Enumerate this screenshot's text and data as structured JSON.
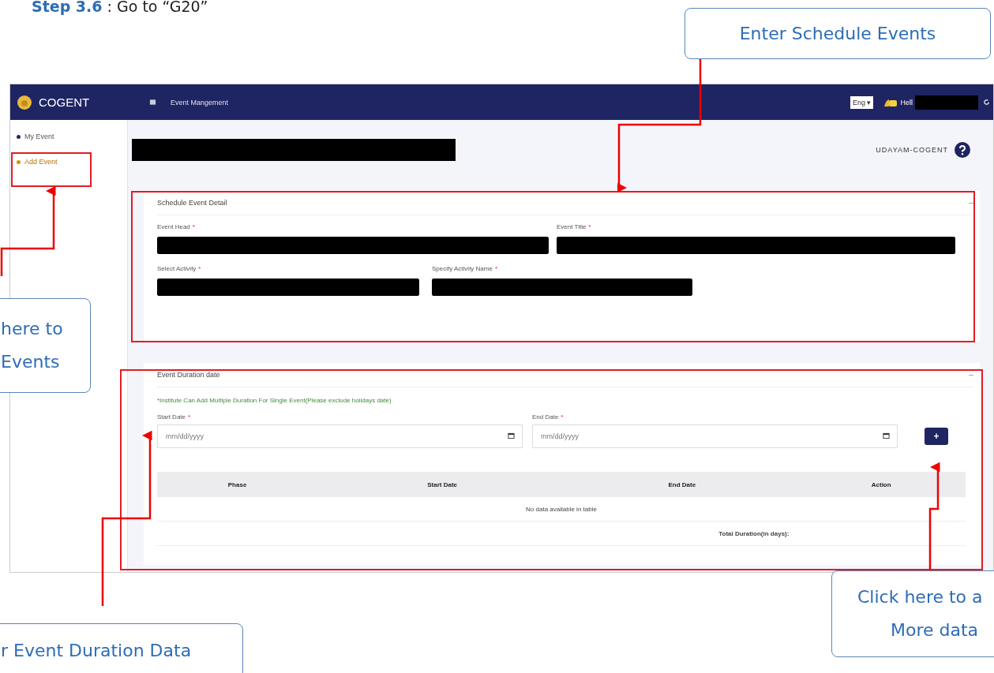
{
  "document": {
    "step_label": "Step 3.6",
    "step_text": " : Go to “G20”"
  },
  "callouts": [
    {
      "lines": [
        "Enter Schedule Events"
      ]
    },
    {
      "lines": [
        "here to",
        "Events"
      ]
    },
    {
      "lines": [
        "r Event Duration Data"
      ]
    },
    {
      "lines": [
        "Click here to a",
        "More data"
      ]
    }
  ],
  "app": {
    "header": {
      "brand": "COGENT",
      "page_title": "Event Mangement",
      "language": "Eng",
      "language_caret": "▾",
      "greeting": "Hell"
    },
    "sidebar": {
      "items": [
        {
          "label": "My Event",
          "selected": false
        },
        {
          "label": "Add Event",
          "selected": true
        }
      ]
    },
    "org_name": "UDAYAM-COGENT",
    "schedule_section": {
      "title": "Schedule Event Detail",
      "fields": [
        {
          "label": "Event Head",
          "required_mark": "*",
          "redacted": true
        },
        {
          "label": "Event Title",
          "required_mark": "*",
          "redacted": true
        },
        {
          "label": "Select Activity",
          "required_mark": "*",
          "redacted": true
        },
        {
          "label": "Specify Activity Name",
          "required_mark": "*",
          "redacted": true
        }
      ]
    },
    "duration_section": {
      "title": "Event Duration date",
      "note": "*Institute Can Add Multiple Duration For Single Event(Please exclude holidays date)",
      "dates": [
        {
          "label": "Start Date",
          "required_mark": "*",
          "placeholder": "mm/dd/yyyy"
        },
        {
          "label": "End Date",
          "required_mark": "*",
          "placeholder": "mm/dd/yyyy"
        }
      ],
      "add_button": "+",
      "table": {
        "columns": [
          "Phase",
          "Start Date",
          "End Date",
          "Action"
        ],
        "empty_message": "No data available in table",
        "footer": "Total Duration(in days):"
      }
    }
  }
}
